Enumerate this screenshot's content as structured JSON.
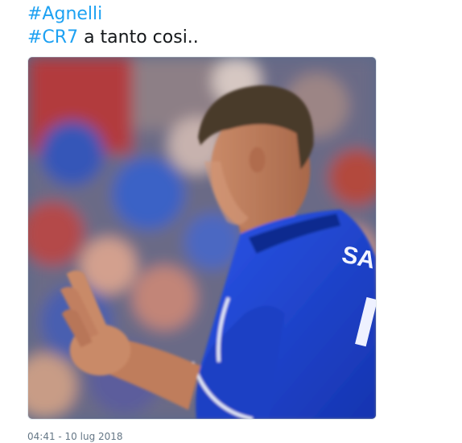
{
  "tweet": {
    "line1": {
      "hashtag": "#Agnelli"
    },
    "line2": {
      "hashtag": "#CR7",
      "text": " a tanto cosi.."
    },
    "timestamp": "04:41 - 10 lug 2018"
  },
  "media": {
    "description_icon": "photo-of-football-player-gesturing",
    "jersey_color": "#1f45d6",
    "jersey_lettering": "SA"
  },
  "colors": {
    "hashtag": "#1da1f2",
    "text": "#14171a",
    "meta": "#657786"
  }
}
